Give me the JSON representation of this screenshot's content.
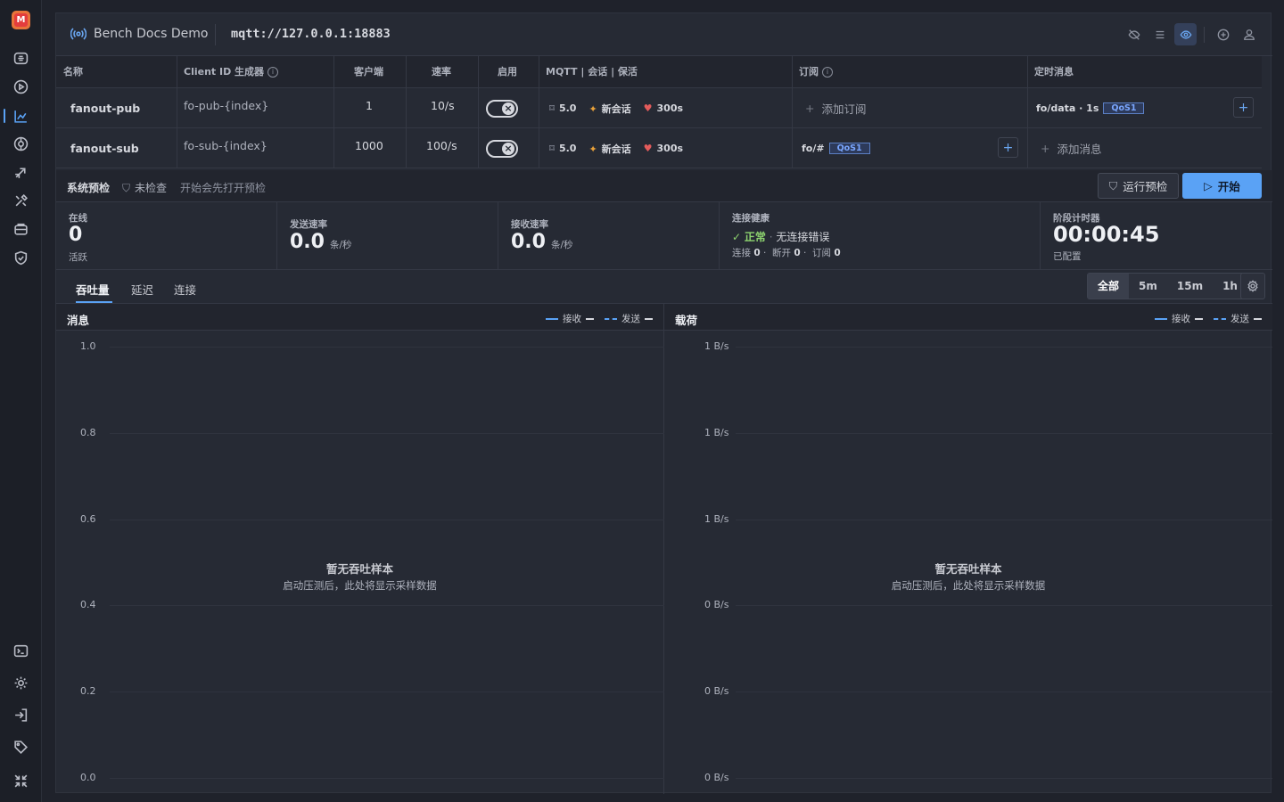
{
  "app": {
    "logo_letter": "M"
  },
  "topbar": {
    "project_name": "Bench Docs Demo",
    "broker_url": "mqtt://127.0.0.1:18883"
  },
  "table": {
    "headers": {
      "name": "名称",
      "client_id": "Client ID 生成器",
      "clients": "客户端",
      "rate": "速率",
      "enabled": "启用",
      "mqtt": "MQTT | 会话 | 保活",
      "subscriptions": "订阅",
      "scheduled": "定时消息"
    },
    "rows": [
      {
        "name": "fanout-pub",
        "client_id": "fo-pub-{index}",
        "clients": "1",
        "rate": "10/s",
        "mqtt_version": "5.0",
        "session": "新会话",
        "keepalive": "300s",
        "subscription_add": "添加订阅",
        "scheduled_topic": "fo/data · 1s",
        "scheduled_qos": "QoS1"
      },
      {
        "name": "fanout-sub",
        "client_id": "fo-sub-{index}",
        "clients": "1000",
        "rate": "100/s",
        "mqtt_version": "5.0",
        "session": "新会话",
        "keepalive": "300s",
        "subscription_topic": "fo/#",
        "subscription_qos": "QoS1",
        "scheduled_add": "添加消息"
      }
    ]
  },
  "preflight": {
    "label": "系统预检",
    "status": "未检查",
    "hint": "开始会先打开预检",
    "run_button": "运行预检",
    "start_button": "开始"
  },
  "stats": {
    "online": {
      "title": "在线",
      "value": "0",
      "sub": "活跃"
    },
    "send_rate": {
      "title": "发送速率",
      "value": "0.0",
      "unit": "条/秒"
    },
    "recv_rate": {
      "title": "接收速率",
      "value": "0.0",
      "unit": "条/秒"
    },
    "health": {
      "title": "连接健康",
      "status": "正常",
      "detail": "无连接错误",
      "conn_label": "连接",
      "conn_value": "0",
      "disc_label": "断开",
      "disc_value": "0",
      "sub_label": "订阅",
      "sub_value": "0"
    },
    "timer": {
      "title": "阶段计时器",
      "value": "00:00:45",
      "sub": "已配置"
    }
  },
  "tabs": [
    "吞吐量",
    "延迟",
    "连接"
  ],
  "ranges": [
    "全部",
    "5m",
    "15m",
    "1h"
  ],
  "charts": {
    "messages": {
      "title": "消息",
      "legend_recv": "接收",
      "legend_send": "发送",
      "yticks": [
        "1.0",
        "0.8",
        "0.6",
        "0.4",
        "0.2",
        "0.0"
      ],
      "empty_title": "暂无吞吐样本",
      "empty_sub": "启动压测后，此处将显示采样数据"
    },
    "payload": {
      "title": "载荷",
      "legend_recv": "接收",
      "legend_send": "发送",
      "yticks": [
        "1 B/s",
        "1 B/s",
        "1 B/s",
        "0 B/s",
        "0 B/s",
        "0 B/s"
      ],
      "empty_title": "暂无吞吐样本",
      "empty_sub": "启动压测后，此处将显示采样数据"
    }
  },
  "colors": {
    "accent": "#5aa2f5",
    "ok": "#8dd36f",
    "logo": "#e8743a"
  }
}
